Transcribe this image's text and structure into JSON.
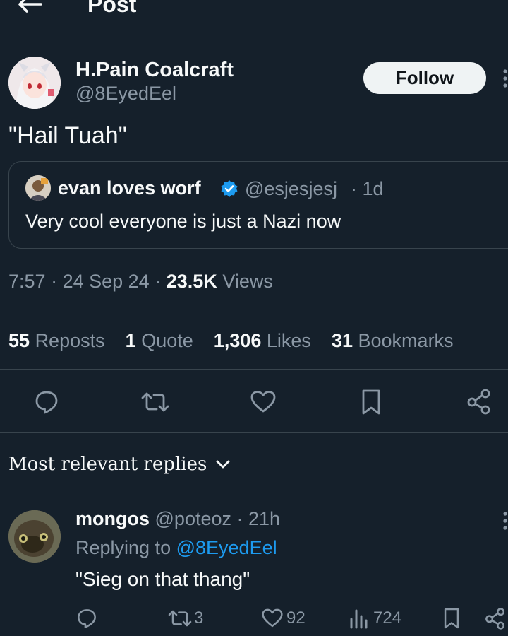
{
  "header": {
    "title": "Post"
  },
  "post": {
    "author_name": "H.Pain Coalcraft",
    "handle": "@8EyedEel",
    "follow_label": "Follow",
    "text": "\"Hail Tuah\"",
    "quote": {
      "author_name": "evan loves worf",
      "handle": "@esjesjesj",
      "time": "· 1d",
      "text": "Very cool everyone is just a Nazi now"
    },
    "time": "7:57",
    "sep1": "·",
    "date": "24 Sep 24",
    "sep2": "·",
    "views_count": "23.5K",
    "views_label": "Views",
    "stats": {
      "reposts_count": "55",
      "reposts_label": "Reposts",
      "quotes_count": "1",
      "quotes_label": "Quote",
      "likes_count": "1,306",
      "likes_label": "Likes",
      "bookmarks_count": "31",
      "bookmarks_label": "Bookmarks"
    }
  },
  "replies_header": {
    "label": "Most relevant replies"
  },
  "reply": {
    "author_name": "mongos",
    "handle": "@poteoz",
    "time": "· 21h",
    "replying_label": "Replying to",
    "replying_handle": "@8EyedEel",
    "text": "\"Sieg on that thang\"",
    "reposts": "3",
    "likes": "92",
    "views": "724"
  },
  "colors": {
    "background": "#15202b",
    "text": "#f7f9f9",
    "muted": "#8b98a5",
    "accent": "#1d9bf0",
    "divider": "#38444d"
  }
}
